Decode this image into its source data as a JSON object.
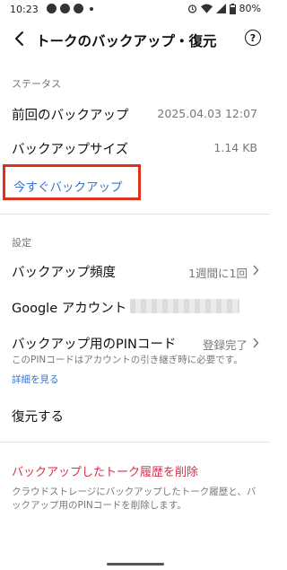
{
  "status_bar": {
    "time": "10:23",
    "battery": "80%",
    "icons": [
      "facebook-icon",
      "chat-icon",
      "facebook-icon",
      "dot-icon",
      "alarm-icon",
      "wifi-icon",
      "signal-icon",
      "battery-icon"
    ]
  },
  "header": {
    "title": "トークのバックアップ・復元",
    "help": "?"
  },
  "status_section": {
    "label": "ステータス",
    "last_backup_label": "前回のバックアップ",
    "last_backup_value": "2025.04.03 12:07",
    "size_label": "バックアップサイズ",
    "size_value": "1.14 KB",
    "backup_now_label": "今すぐバックアップ"
  },
  "settings_section": {
    "label": "設定",
    "frequency_label": "バックアップ頻度",
    "frequency_value": "1週間に1回",
    "google_account_label": "Google アカウント",
    "pin_label": "バックアップ用のPINコード",
    "pin_value": "登録完了",
    "pin_note": "このPINコードはアカウントの引き継ぎ時に必要です。",
    "details_link": "詳細を見る",
    "restore_label": "復元する"
  },
  "delete_section": {
    "label": "バックアップしたトーク履歴を削除",
    "note": "クラウドストレージにバックアップしたトーク履歴と、バックアップ用のPINコードを削除します。"
  },
  "colors": {
    "accent_blue": "#3b74c8",
    "highlight_red": "#e0311d",
    "danger_pink": "#d62f4a"
  }
}
